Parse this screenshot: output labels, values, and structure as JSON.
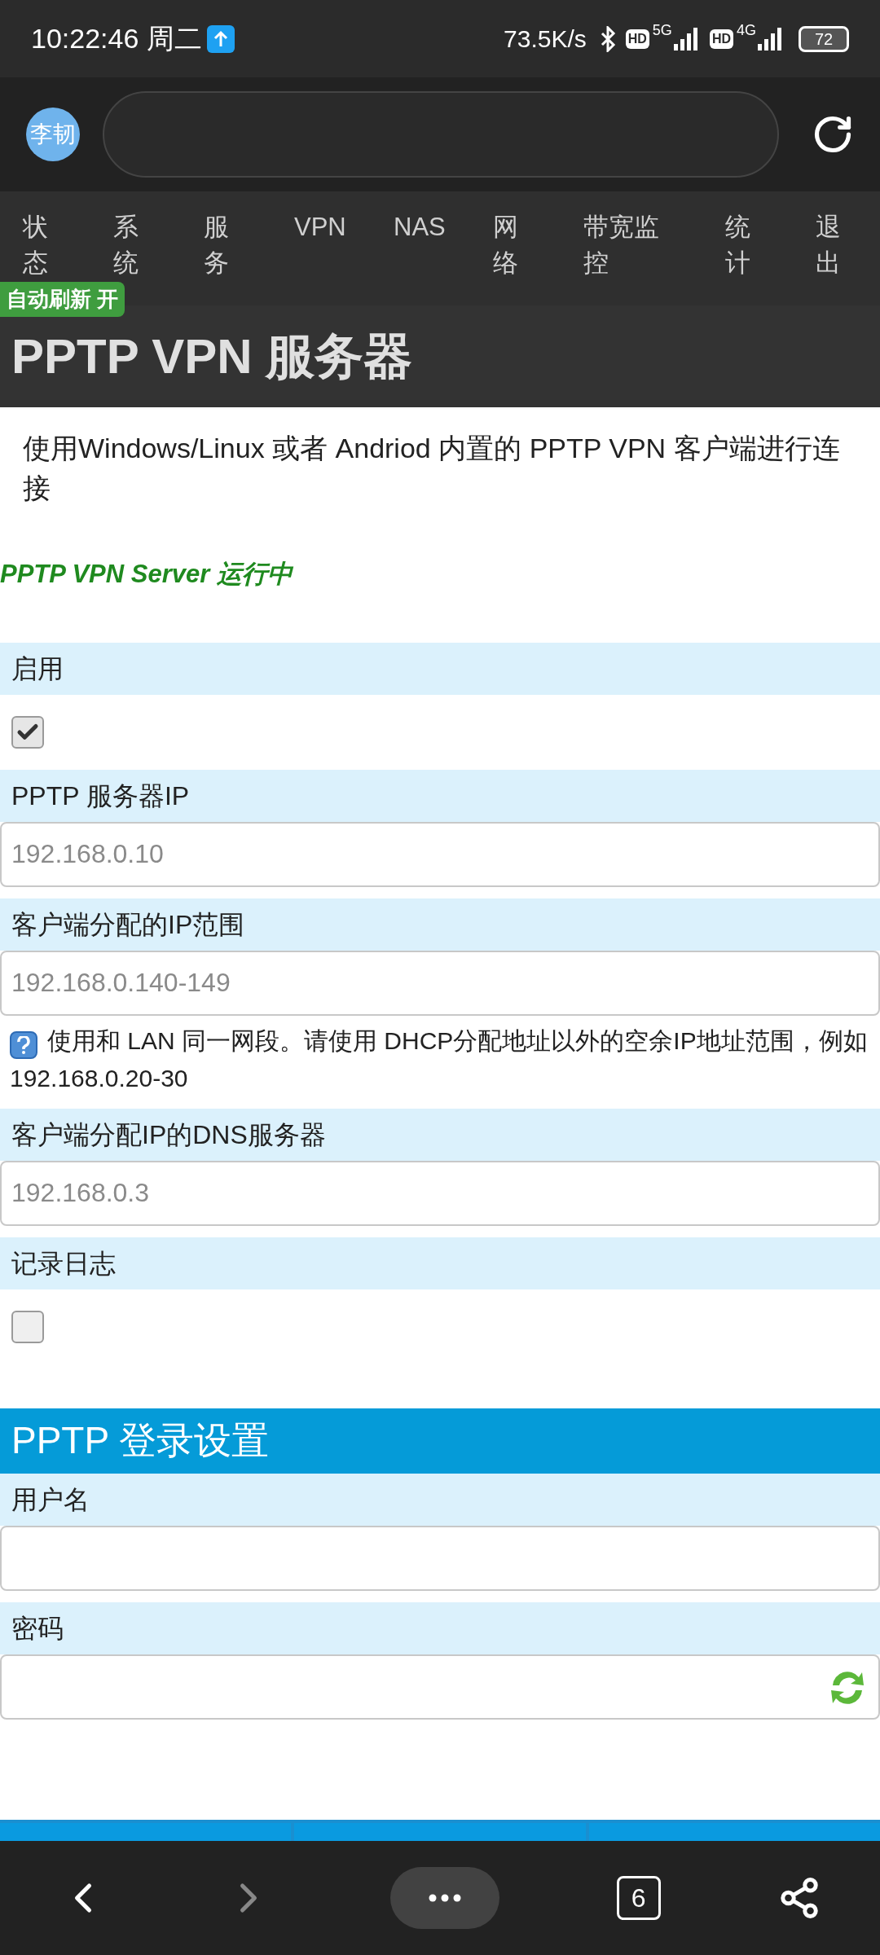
{
  "status_bar": {
    "time": "10:22:46 周二",
    "speed": "73.5K/s",
    "sim1": "5G",
    "sim2": "4G",
    "hd1": "HD",
    "hd2": "HD",
    "battery": "72"
  },
  "browser": {
    "avatar": "李韧"
  },
  "nav": [
    {
      "label": "状态"
    },
    {
      "label": "系统"
    },
    {
      "label": "服务"
    },
    {
      "label": "VPN"
    },
    {
      "label": "NAS"
    },
    {
      "label": "网络"
    },
    {
      "label": "带宽监控"
    },
    {
      "label": "统计"
    },
    {
      "label": "退出"
    }
  ],
  "auto_refresh_badge": "自动刷新 开",
  "page_title": "PPTP VPN 服务器",
  "description": "使用Windows/Linux 或者 Andriod 内置的 PPTP VPN 客户端进行连接",
  "server_status": "PPTP VPN Server 运行中",
  "fields": [
    {
      "kind": "checkbox",
      "label": "启用",
      "checked": true
    },
    {
      "kind": "input",
      "label": "PPTP 服务器IP",
      "placeholder": "192.168.0.10"
    },
    {
      "kind": "input",
      "label": "客户端分配的IP范围",
      "placeholder": "192.168.0.140-149",
      "help": "使用和 LAN 同一网段。请使用 DHCP分配地址以外的空余IP地址范围，例如 192.168.0.20-30"
    },
    {
      "kind": "input",
      "label": "客户端分配IP的DNS服务器",
      "placeholder": "192.168.0.3"
    },
    {
      "kind": "checkbox",
      "label": "记录日志",
      "checked": false
    }
  ],
  "login_section": {
    "title": "PPTP 登录设置",
    "fields": [
      {
        "kind": "input",
        "label": "用户名"
      },
      {
        "kind": "password",
        "label": "密码"
      }
    ]
  },
  "bottom_bar": {
    "tabs_count": "6"
  }
}
